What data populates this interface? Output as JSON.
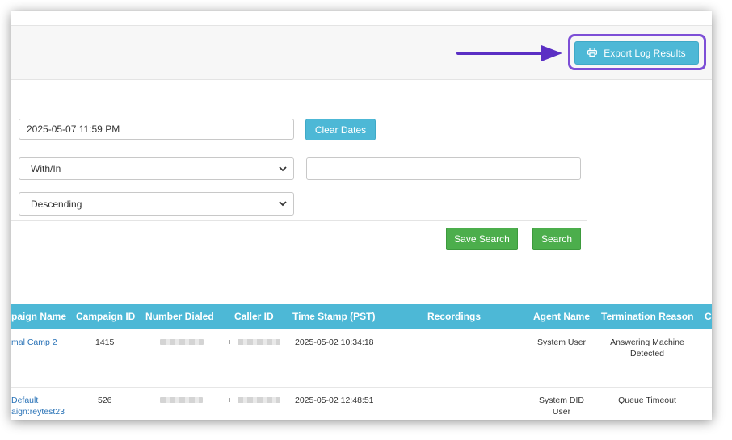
{
  "toolbar": {
    "export_label": "Export Log Results",
    "export_icon": "printer-icon"
  },
  "filters": {
    "end_date_value": "2025-05-07 11:59 PM",
    "clear_dates_label": "Clear Dates",
    "match_select_value": "With/In",
    "search_text_value": "",
    "order_select_value": "Descending",
    "save_search_label": "Save Search",
    "search_label": "Search"
  },
  "table": {
    "headers": [
      "paign Name",
      "Campaign ID",
      "Number Dialed",
      "Caller ID",
      "Time Stamp (PST)",
      "Recordings",
      "Agent Name",
      "Termination Reason",
      "C"
    ],
    "rows": [
      {
        "campaign_name": [
          "mal Camp 2"
        ],
        "campaign_id": "1415",
        "caller_prefix": "+",
        "timestamp": "2025-05-02 10:34:18",
        "agent_name": [
          "System User"
        ],
        "termination_reason": [
          "Answering Machine",
          "Detected"
        ]
      },
      {
        "campaign_name": [
          " Default",
          "aign:reytest23"
        ],
        "campaign_id": "526",
        "caller_prefix": "+",
        "timestamp": "2025-05-02 12:48:51",
        "agent_name": [
          "System DID",
          "User"
        ],
        "termination_reason": [
          "Queue Timeout"
        ]
      }
    ]
  },
  "colors": {
    "accent": "#4db8d6",
    "success": "#4cae4c",
    "highlight": "#7d4fd6",
    "link": "#2a73b7"
  }
}
